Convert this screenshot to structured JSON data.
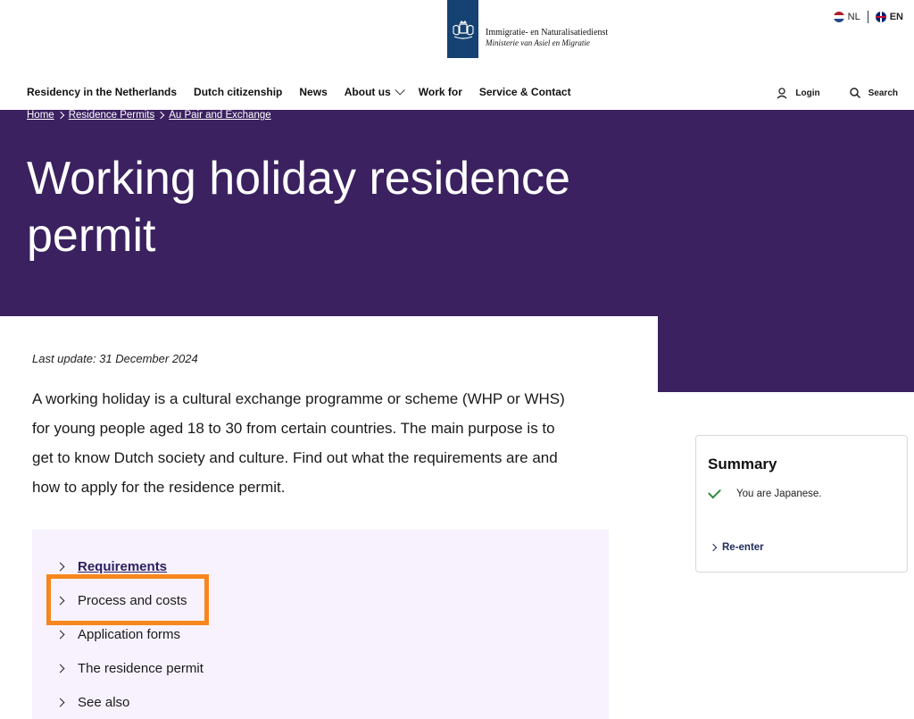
{
  "header": {
    "org_name": "Immigratie- en Naturalisatiedienst",
    "ministry": "Ministerie van Asiel en Migratie",
    "lang_nl": "NL",
    "lang_en": "EN"
  },
  "nav": {
    "items": [
      "Residency in the Netherlands",
      "Dutch citizenship",
      "News",
      "About us",
      "Work for",
      "Service & Contact"
    ],
    "login": "Login",
    "search": "Search"
  },
  "breadcrumb": [
    "Home",
    "Residence Permits",
    "Au Pair and Exchange"
  ],
  "page": {
    "title": "Working holiday residence permit",
    "last_update": "Last update: 31 December 2024",
    "intro": "A working holiday is a cultural exchange programme or scheme (WHP or WHS) for young people aged 18 to 30 from certain countries. The main purpose is to get to know Dutch society and culture. Find out what the requirements are and how to apply for the residence permit."
  },
  "toc": {
    "items": [
      "Requirements",
      "Process and costs",
      "Application forms",
      "The residence permit",
      "See also"
    ]
  },
  "summary": {
    "title": "Summary",
    "line": "You are Japanese.",
    "reenter": "Re-enter"
  },
  "colors": {
    "hero": "#3b2160",
    "highlight": "#f7871c",
    "toc_bg": "#f7f2fd",
    "logo_bg": "#154273"
  }
}
